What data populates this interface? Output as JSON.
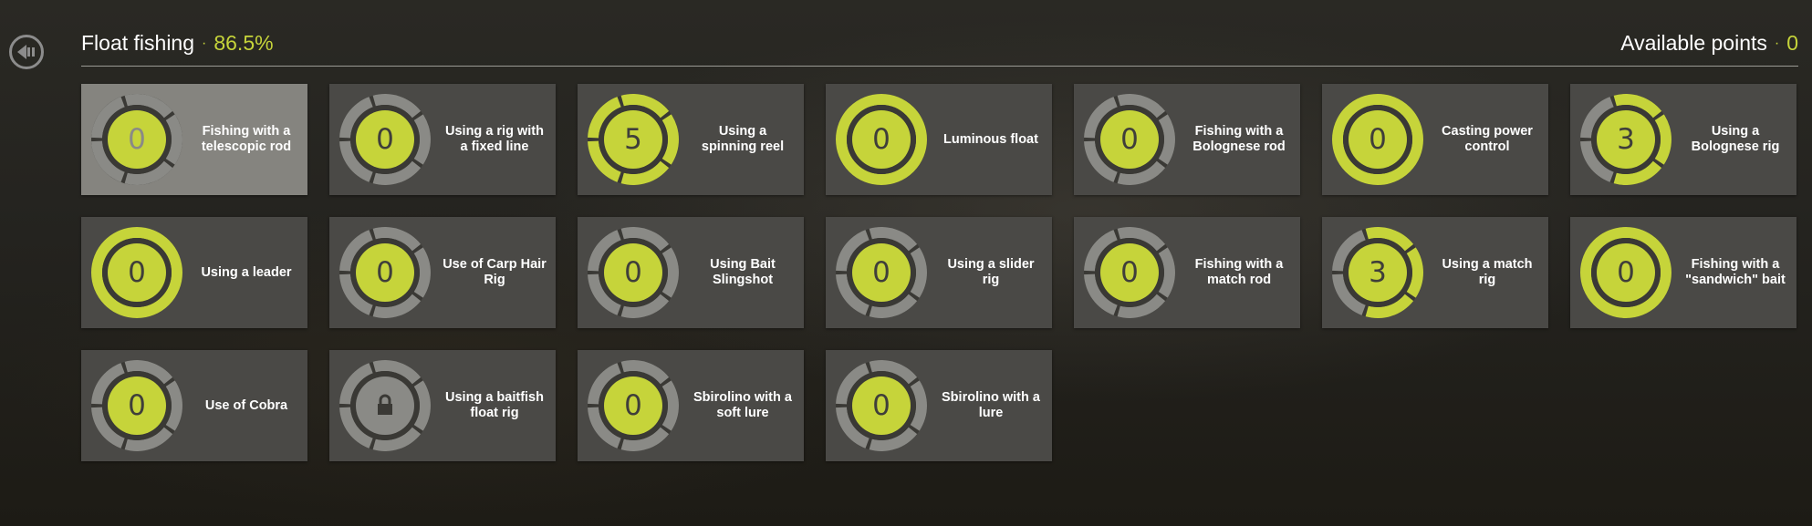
{
  "header": {
    "title": "Float fishing",
    "separator": "·",
    "progress_percent": "86.5%",
    "available_points_label": "Available points",
    "available_points_value": "0"
  },
  "colors": {
    "accent": "#c6d43a",
    "ring_gray": "#8a8a86",
    "card_bg": "#4a4946",
    "card_selected_bg": "#85847f"
  },
  "icons": {
    "back": "back-arrow-icon",
    "lock": "lock-icon"
  },
  "skills": [
    {
      "name": "Fishing with a telescopic rod",
      "level": "0",
      "ring_filled": 0,
      "center_active": true,
      "locked": false,
      "selected": true
    },
    {
      "name": "Using a rig with a fixed line",
      "level": "0",
      "ring_filled": 0,
      "center_active": true,
      "locked": false,
      "selected": false
    },
    {
      "name": "Using a spinning reel",
      "level": "5",
      "ring_filled": 5,
      "center_active": true,
      "locked": false,
      "selected": false
    },
    {
      "name": "Luminous float",
      "level": "0",
      "ring_filled": 1,
      "center_active": true,
      "locked": false,
      "selected": false
    },
    {
      "name": "Fishing with a Bolognese rod",
      "level": "0",
      "ring_filled": 0,
      "center_active": true,
      "locked": false,
      "selected": false
    },
    {
      "name": "Casting power control",
      "level": "0",
      "ring_filled": 1,
      "center_active": true,
      "locked": false,
      "selected": false
    },
    {
      "name": "Using a Bolognese rig",
      "level": "3",
      "ring_filled": 3,
      "center_active": true,
      "locked": false,
      "selected": false
    },
    {
      "name": "Using a leader",
      "level": "0",
      "ring_filled": 1,
      "center_active": true,
      "locked": false,
      "selected": false
    },
    {
      "name": "Use of Carp Hair Rig",
      "level": "0",
      "ring_filled": 0,
      "center_active": true,
      "locked": false,
      "selected": false
    },
    {
      "name": "Using Bait Slingshot",
      "level": "0",
      "ring_filled": 0,
      "center_active": true,
      "locked": false,
      "selected": false
    },
    {
      "name": "Using a slider rig",
      "level": "0",
      "ring_filled": 0,
      "center_active": true,
      "locked": false,
      "selected": false
    },
    {
      "name": "Fishing with a match rod",
      "level": "0",
      "ring_filled": 0,
      "center_active": true,
      "locked": false,
      "selected": false
    },
    {
      "name": "Using a match rig",
      "level": "3",
      "ring_filled": 3,
      "center_active": true,
      "locked": false,
      "selected": false
    },
    {
      "name": "Fishing with a \"sandwich\" bait",
      "level": "0",
      "ring_filled": 1,
      "center_active": true,
      "locked": false,
      "selected": false
    },
    {
      "name": "Use of Cobra",
      "level": "0",
      "ring_filled": 0,
      "center_active": true,
      "locked": false,
      "selected": false
    },
    {
      "name": "Using a baitfish float rig",
      "level": "",
      "ring_filled": 0,
      "center_active": false,
      "locked": true,
      "selected": false
    },
    {
      "name": "Sbirolino with a soft lure",
      "level": "0",
      "ring_filled": 0,
      "center_active": true,
      "locked": false,
      "selected": false
    },
    {
      "name": "Sbirolino with a lure",
      "level": "0",
      "ring_filled": 0,
      "center_active": true,
      "locked": false,
      "selected": false
    }
  ]
}
